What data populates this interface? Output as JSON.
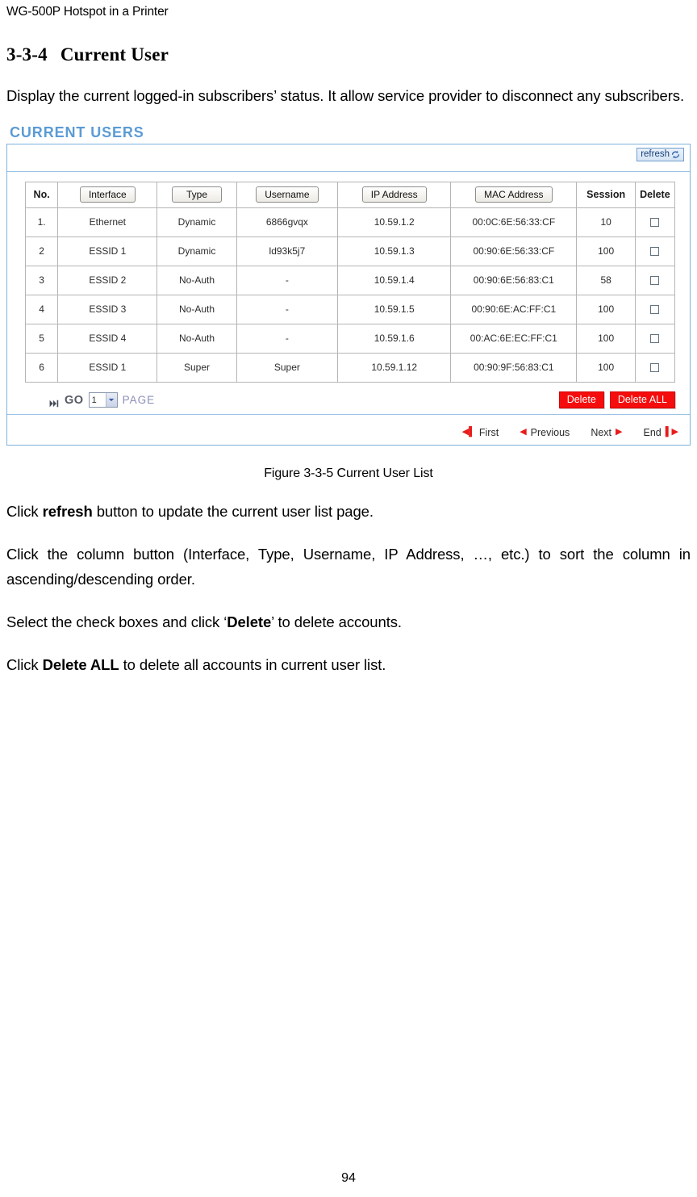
{
  "document": {
    "running_header": "WG-500P Hotspot in a Printer",
    "page_number": "94",
    "section_number": "3-3-4",
    "section_title": "Current User",
    "intro_paragraph": "Display the current logged-in subscribers’ status. It allow service provider to disconnect any subscribers.",
    "figure_caption": "Figure 3-3-5 Current User List",
    "paragraphs": [
      {
        "parts": [
          {
            "text": "Click ",
            "bold": false
          },
          {
            "text": "refresh",
            "bold": true
          },
          {
            "text": " button to update the current user list page.",
            "bold": false
          }
        ]
      },
      {
        "parts": [
          {
            "text": "Click the column button (Interface, Type, Username, IP Address, …, etc.) to sort the column in ascending/descending order.",
            "bold": false
          }
        ]
      },
      {
        "parts": [
          {
            "text": "Select the check boxes and click ‘",
            "bold": false
          },
          {
            "text": "Delete",
            "bold": true
          },
          {
            "text": "’ to delete accounts.",
            "bold": false
          }
        ]
      },
      {
        "parts": [
          {
            "text": "Click ",
            "bold": false
          },
          {
            "text": "Delete ALL",
            "bold": true
          },
          {
            "text": " to delete all accounts in current user list.",
            "bold": false
          }
        ]
      }
    ]
  },
  "screenshot": {
    "panel_title": "CURRENT USERS",
    "refresh_label": "refresh",
    "refresh_icon": "refresh-circular-arrow-icon",
    "table": {
      "headers": [
        {
          "label": "No.",
          "sortable": false
        },
        {
          "label": "Interface",
          "sortable": true
        },
        {
          "label": "Type",
          "sortable": true
        },
        {
          "label": "Username",
          "sortable": true
        },
        {
          "label": "IP Address",
          "sortable": true
        },
        {
          "label": "MAC Address",
          "sortable": true
        },
        {
          "label": "Session",
          "sortable": false
        },
        {
          "label": "Delete",
          "sortable": false
        }
      ],
      "rows": [
        {
          "no": "1.",
          "interface": "Ethernet",
          "type": "Dynamic",
          "username": "6866gvqx",
          "ip": "10.59.1.2",
          "mac": "00:0C:6E:56:33:CF",
          "session": "10"
        },
        {
          "no": "2",
          "interface": "ESSID 1",
          "type": "Dynamic",
          "username": "ld93k5j7",
          "ip": "10.59.1.3",
          "mac": "00:90:6E:56:33:CF",
          "session": "100"
        },
        {
          "no": "3",
          "interface": "ESSID 2",
          "type": "No-Auth",
          "username": "-",
          "ip": "10.59.1.4",
          "mac": "00:90:6E:56:83:C1",
          "session": "58"
        },
        {
          "no": "4",
          "interface": "ESSID 3",
          "type": "No-Auth",
          "username": "-",
          "ip": "10.59.1.5",
          "mac": "00:90:6E:AC:FF:C1",
          "session": "100"
        },
        {
          "no": "5",
          "interface": "ESSID 4",
          "type": "No-Auth",
          "username": "-",
          "ip": "10.59.1.6",
          "mac": "00:AC:6E:EC:FF:C1",
          "session": "100"
        },
        {
          "no": "6",
          "interface": "ESSID 1",
          "type": "Super",
          "username": "Super",
          "ip": "10.59.1.12",
          "mac": "00:90:9F:56:83:C1",
          "session": "100"
        }
      ]
    },
    "controls": {
      "go_label": "GO",
      "go_icon": "double-arrow-right-icon",
      "page_value": "1",
      "page_options": [
        "1"
      ],
      "page_word": "PAGE",
      "delete_label": "Delete",
      "delete_all_label": "Delete ALL"
    },
    "pagination": {
      "first": "First",
      "previous": "Previous",
      "next": "Next",
      "end": "End"
    },
    "colors": {
      "panel_title": "#5b9bd5",
      "panel_border": "#7fb2de",
      "delete_button": "#f50d0d",
      "nav_glyph": "#e81c1c"
    }
  }
}
